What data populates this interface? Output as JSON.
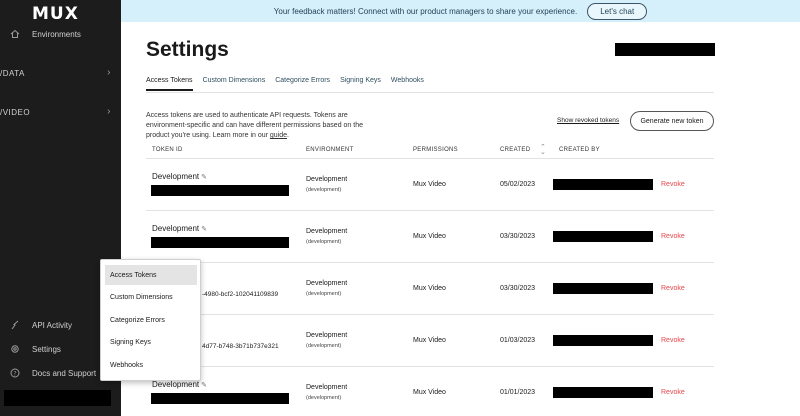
{
  "app": {
    "logo_text": "MUX"
  },
  "sidebar": {
    "environments": {
      "label": "Environments",
      "icon": "home-icon"
    },
    "sections": [
      {
        "label": "/DATA",
        "icon": "chevron-right-icon"
      },
      {
        "label": "/VIDEO",
        "icon": "chevron-right-icon"
      }
    ],
    "bottom": [
      {
        "label": "API Activity",
        "icon": "activity-icon"
      },
      {
        "label": "Settings",
        "icon": "gear-icon"
      },
      {
        "label": "Docs and Support",
        "icon": "help-icon"
      }
    ]
  },
  "banner": {
    "text": "Your feedback matters! Connect with our product managers to share your experience.",
    "button": "Let's chat",
    "bg_color": "#d6f0fb"
  },
  "page": {
    "title": "Settings"
  },
  "tabs": [
    "Access Tokens",
    "Custom Dimensions",
    "Categorize Errors",
    "Signing Keys",
    "Webhooks"
  ],
  "active_tab": "Access Tokens",
  "intro": {
    "text": "Access tokens are used to authenticate API requests. Tokens are environment-specific and can have different permissions based on the product you're using. Learn more in our ",
    "link": "guide",
    "period": ".",
    "show_revoked": "Show revoked tokens",
    "generate_button": "Generate new token"
  },
  "table": {
    "headers": [
      "TOKEN ID",
      "ENVIRONMENT",
      "PERMISSIONS",
      "CREATED",
      "CREATED BY"
    ],
    "rows": [
      {
        "name": "Development",
        "id_text": "",
        "environment": "Development",
        "env_sub": "(development)",
        "permissions": "Mux Video",
        "created": "05/02/2023",
        "action": "Revoke"
      },
      {
        "name": "Development",
        "id_text": "",
        "environment": "Development",
        "env_sub": "(development)",
        "permissions": "Mux Video",
        "created": "03/30/2023",
        "action": "Revoke"
      },
      {
        "name": "",
        "id_text": "-4980-bcf2-102041109839",
        "environment": "Development",
        "env_sub": "(development)",
        "permissions": "Mux Video",
        "created": "03/30/2023",
        "action": "Revoke"
      },
      {
        "name": "",
        "id_text": "4d77-b748-3b71b737e321",
        "environment": "Development",
        "env_sub": "(development)",
        "permissions": "Mux Video",
        "created": "01/03/2023",
        "action": "Revoke"
      },
      {
        "name": "Development",
        "id_text": "",
        "environment": "Development",
        "env_sub": "(development)",
        "permissions": "Mux Video",
        "created": "01/01/2023",
        "action": "Revoke"
      }
    ]
  },
  "popup_menu": {
    "items": [
      "Access Tokens",
      "Custom Dimensions",
      "Categorize Errors",
      "Signing Keys",
      "Webhooks"
    ],
    "selected": "Access Tokens"
  },
  "colors": {
    "revoke": "#e5484d",
    "sidebar_bg": "#1c1c1c"
  }
}
